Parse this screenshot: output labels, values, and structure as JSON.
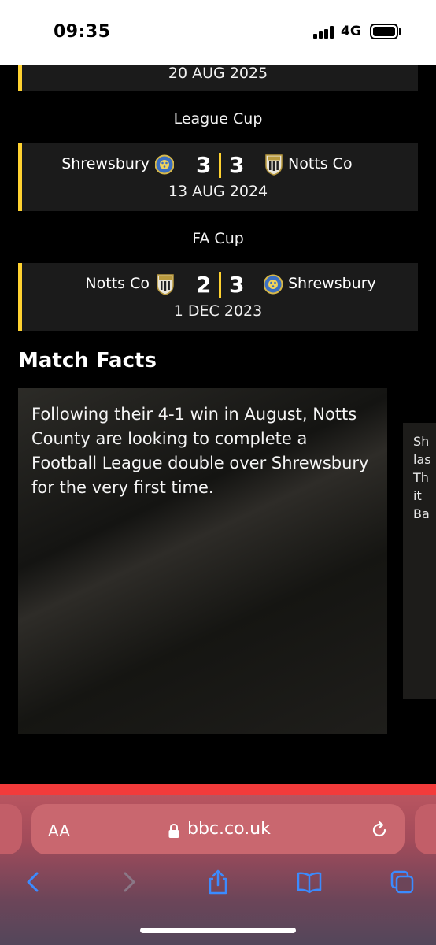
{
  "status_bar": {
    "time": "09:35",
    "network": "4G"
  },
  "matches": {
    "top_date": "20 AUG 2025",
    "league_cup": {
      "competition": "League Cup",
      "home_team": "Shrewsbury",
      "home_score": "3",
      "away_score": "3",
      "away_team": "Notts Co",
      "date": "13 AUG 2024"
    },
    "fa_cup": {
      "competition": "FA Cup",
      "home_team": "Notts Co",
      "home_score": "2",
      "away_score": "3",
      "away_team": "Shrewsbury",
      "date": "1 DEC 2023"
    }
  },
  "match_facts": {
    "title": "Match Facts",
    "fact_1": "Following their 4-1 win in August, Notts County are looking to complete a Football League double over Shrewsbury for the very first time.",
    "fact_2_partial": "Sh\nlas\nTh\nit \nBa"
  },
  "browser": {
    "aa_label": "AA",
    "url": "bbc.co.uk"
  },
  "colors": {
    "accent": "#ffd230",
    "card": "#1b1b1b",
    "browser_red": "#f33b3b"
  }
}
